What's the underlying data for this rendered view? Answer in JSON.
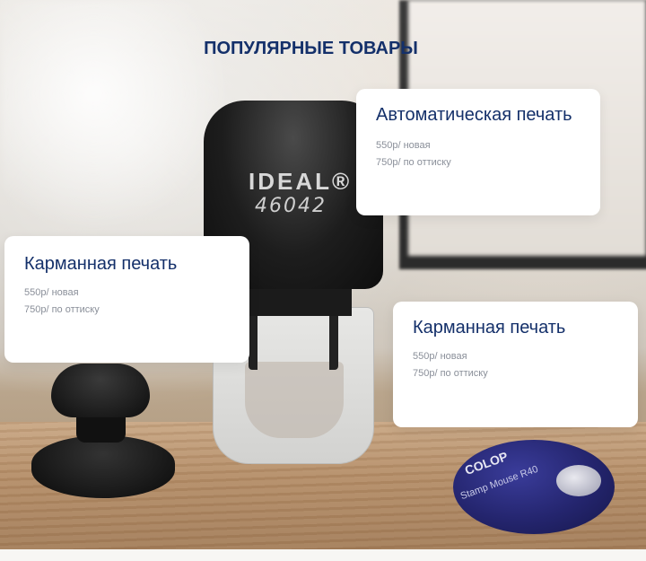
{
  "section": {
    "title": "ПОПУЛЯРНЫЕ ТОВАРЫ"
  },
  "products": [
    {
      "title": "Автоматическая печать",
      "price_new": "550р/ новая",
      "price_copy": "750р/ по оттиску"
    },
    {
      "title": "Карманная печать",
      "price_new": "550р/ новая",
      "price_copy": "750р/ по оттиску"
    },
    {
      "title": "Карманная печать",
      "price_new": "550р/ новая",
      "price_copy": "750р/ по оттиску"
    }
  ],
  "illustration": {
    "stamp_brand": "IDEAL®",
    "stamp_model": "46042",
    "pocket_brand": "COLOP",
    "pocket_sub": "Stamp Mouse R40"
  }
}
